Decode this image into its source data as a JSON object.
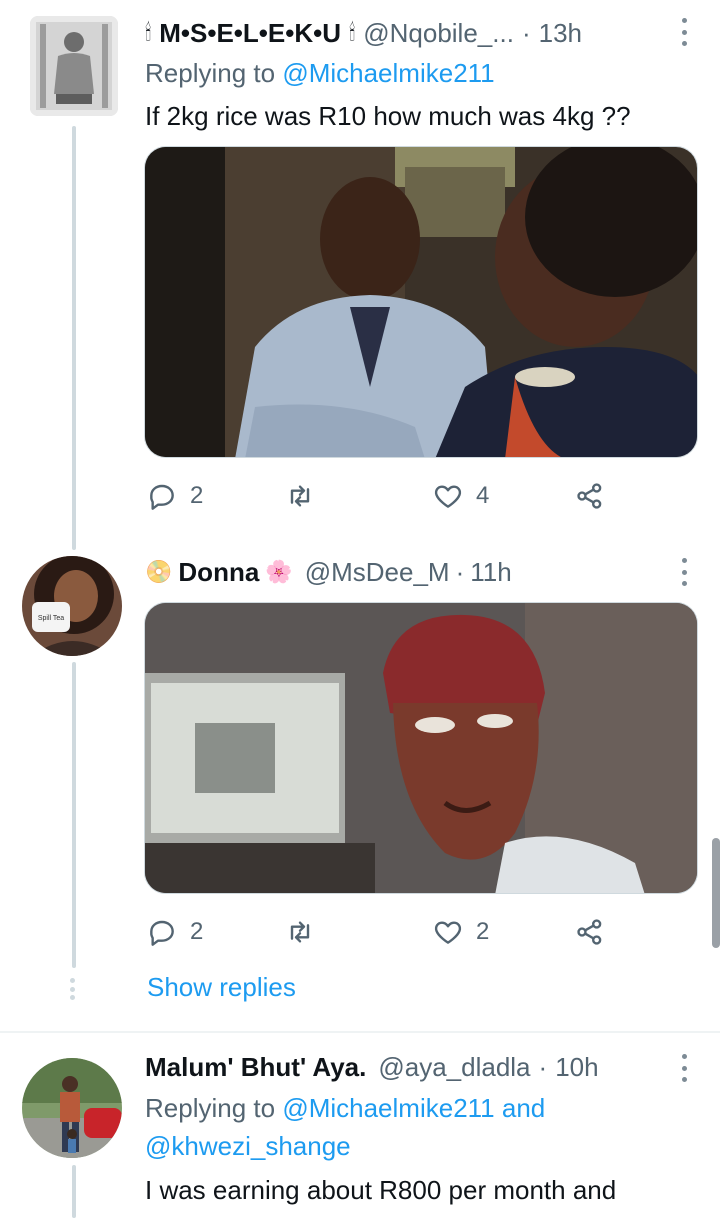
{
  "tweets": [
    {
      "display_name": "M•S•E•L•E•K•U",
      "name_prefix_emoji": "🕯",
      "name_suffix_emoji": "🕯",
      "handle": "@Nqobile_...",
      "dot": "·",
      "time": "13h",
      "replying_label": "Replying to",
      "replying_to": "@Michaelmike211",
      "text": "If 2kg rice was R10 how much was 4kg ??",
      "replies": "2",
      "retweets": "",
      "likes": "4"
    },
    {
      "display_name": "Donna",
      "name_prefix_emoji": "📀",
      "name_suffix_emoji": "🌸",
      "handle": "@MsDee_M",
      "dot": "·",
      "time": "11h",
      "replies": "2",
      "retweets": "",
      "likes": "2",
      "avatar_cup_text": "Spill Tea"
    },
    {
      "display_name": "Malum' Bhut' Aya.",
      "handle": "@aya_dladla",
      "dot": "·",
      "time": "10h",
      "replying_label": "Replying to",
      "replying_to": "@Michaelmike211",
      "replying_joiner": "and",
      "replying_to_2": "@khwezi_shange",
      "text": "I was earning about R800 per month and"
    }
  ],
  "show_replies_label": "Show replies",
  "colors": {
    "accent": "#1d9bf0",
    "secondary_text": "#536471",
    "thread_line": "#cfd9de"
  }
}
